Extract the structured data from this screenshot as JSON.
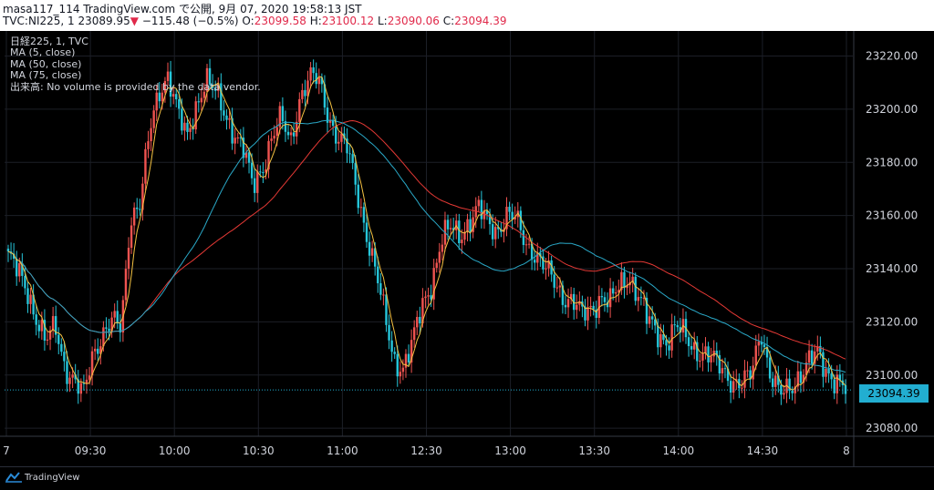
{
  "header": {
    "line1": {
      "author": "masa117_114",
      "site": "TradingView.com",
      "text": "で公開, 9月 07, 2020 19:58:13 JST"
    },
    "line2": {
      "symbol": "TVC:NI225, 1",
      "last": "23089.95",
      "arrow": "▼",
      "change": "−115.48 (−0.5%)",
      "o_label": "O:",
      "o": "23099.58",
      "h_label": "H:",
      "h": "23100.12",
      "l_label": "L:",
      "l": "23090.06",
      "c_label": "C:",
      "c": "23094.39"
    }
  },
  "legend": [
    "日経225, 1, TVC",
    "MA (5, close)",
    "MA (50, close)",
    "MA (75, close)",
    "出来高: No volume is provided by the data vendor."
  ],
  "price_tag": "23094.39",
  "brand": "TradingView",
  "colors": {
    "up": "#ef5350",
    "down": "#26c6da",
    "ma5": "#f5c242",
    "ma50": "#2aa9c8",
    "ma75": "#e53935",
    "grid": "#1c1f27",
    "tag": "#22aed1"
  },
  "chart_data": {
    "type": "candlestick",
    "y_ticks": [
      "23220.00",
      "23200.00",
      "23180.00",
      "23160.00",
      "23140.00",
      "23120.00",
      "23100.00",
      "23080.00"
    ],
    "y_tick_values": [
      23220,
      23200,
      23180,
      23160,
      23140,
      23120,
      23100,
      23080
    ],
    "x_ticks": [
      "7",
      "09:30",
      "10:00",
      "10:30",
      "11:00",
      "12:30",
      "13:00",
      "13:30",
      "14:00",
      "14:30",
      "8"
    ],
    "ylim": [
      23078,
      23226
    ],
    "close_path": [
      [
        0,
        23145
      ],
      [
        2,
        23132
      ],
      [
        4,
        23112
      ],
      [
        5,
        23118
      ],
      [
        6,
        23104
      ],
      [
        7,
        23098
      ],
      [
        8,
        23092
      ],
      [
        9,
        23108
      ],
      [
        10,
        23116
      ],
      [
        11,
        23120
      ],
      [
        12,
        23117
      ],
      [
        13,
        23160
      ],
      [
        14,
        23165
      ],
      [
        15,
        23190
      ],
      [
        16,
        23206
      ],
      [
        17,
        23214
      ],
      [
        18,
        23199
      ],
      [
        19,
        23188
      ],
      [
        20,
        23202
      ],
      [
        21,
        23212
      ],
      [
        22,
        23206
      ],
      [
        23,
        23198
      ],
      [
        24,
        23192
      ],
      [
        25,
        23185
      ],
      [
        26,
        23170
      ],
      [
        27,
        23178
      ],
      [
        28,
        23190
      ],
      [
        29,
        23196
      ],
      [
        30,
        23187
      ],
      [
        31,
        23205
      ],
      [
        32,
        23212
      ],
      [
        33,
        23210
      ],
      [
        34,
        23198
      ],
      [
        35,
        23190
      ],
      [
        36,
        23185
      ],
      [
        37,
        23170
      ],
      [
        38,
        23155
      ],
      [
        39,
        23140
      ],
      [
        40,
        23122
      ],
      [
        41,
        23106
      ],
      [
        42,
        23103
      ],
      [
        43,
        23112
      ],
      [
        44,
        23126
      ],
      [
        45,
        23135
      ],
      [
        46,
        23150
      ],
      [
        47,
        23155
      ],
      [
        48,
        23153
      ],
      [
        49,
        23158
      ],
      [
        50,
        23162
      ],
      [
        51,
        23157
      ],
      [
        52,
        23155
      ],
      [
        53,
        23160
      ],
      [
        54,
        23158
      ],
      [
        55,
        23150
      ],
      [
        56,
        23146
      ],
      [
        57,
        23140
      ],
      [
        58,
        23135
      ],
      [
        59,
        23130
      ],
      [
        60,
        23128
      ],
      [
        61,
        23122
      ],
      [
        62,
        23125
      ],
      [
        63,
        23130
      ],
      [
        64,
        23127
      ],
      [
        65,
        23133
      ],
      [
        66,
        23138
      ],
      [
        67,
        23130
      ],
      [
        68,
        23120
      ],
      [
        69,
        23116
      ],
      [
        70,
        23113
      ],
      [
        71,
        23118
      ],
      [
        72,
        23114
      ],
      [
        73,
        23110
      ],
      [
        74,
        23108
      ],
      [
        75,
        23105
      ],
      [
        76,
        23102
      ],
      [
        77,
        23098
      ],
      [
        78,
        23096
      ],
      [
        79,
        23100
      ],
      [
        80,
        23118
      ],
      [
        81,
        23100
      ],
      [
        82,
        23092
      ],
      [
        83,
        23095
      ],
      [
        84,
        23100
      ],
      [
        85,
        23104
      ],
      [
        86,
        23108
      ],
      [
        87,
        23102
      ],
      [
        88,
        23098
      ],
      [
        89,
        23094
      ]
    ]
  }
}
